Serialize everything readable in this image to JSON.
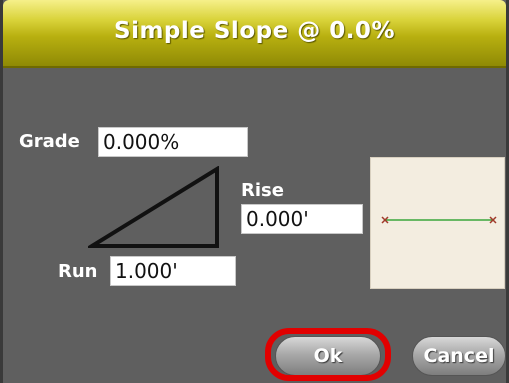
{
  "dialog": {
    "title": "Simple Slope @ 0.0%",
    "accent_color": "#c9c21a"
  },
  "fields": {
    "grade_label": "Grade",
    "grade_value": "0.000%",
    "rise_label": "Rise",
    "rise_value": "0.000'",
    "run_label": "Run",
    "run_value": "1.000'"
  },
  "buttons": {
    "ok_label": "Ok",
    "cancel_label": "Cancel"
  },
  "colors": {
    "panel_bg": "#5f5f5f",
    "preview_line": "#3aa63a",
    "preview_marker": "#a03a2a",
    "highlight": "#e10000"
  }
}
